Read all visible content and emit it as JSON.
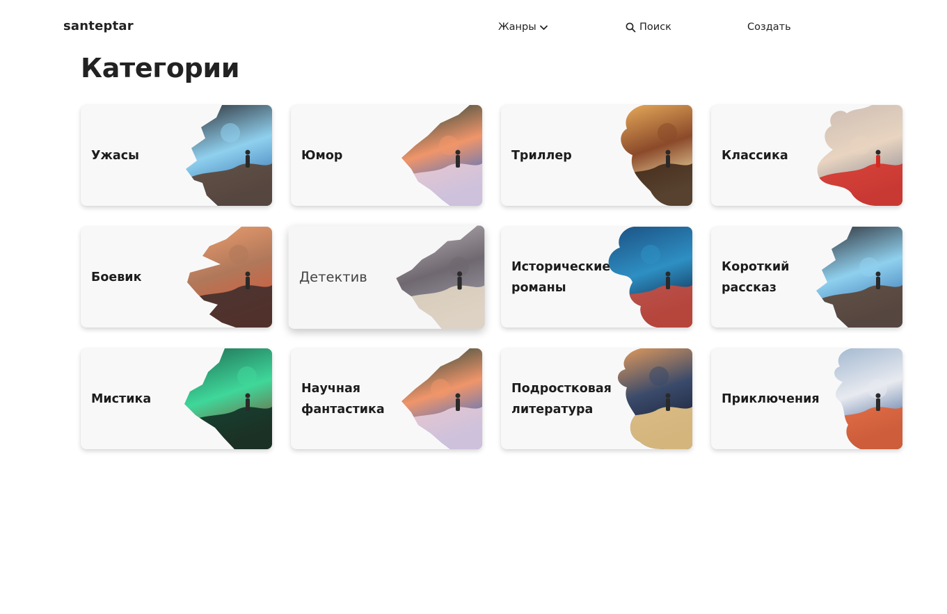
{
  "nav": {
    "logo": "santeptar",
    "genres_label": "Жанры",
    "search_label": "Поиск",
    "create_label": "Создать"
  },
  "page": {
    "title": "Категории"
  },
  "categories": [
    {
      "label": "Ужасы",
      "palette": [
        "#2a2a30",
        "#8fd0ee",
        "#5a3d2a",
        "#3b78b5"
      ]
    },
    {
      "label": "Юмор",
      "palette": [
        "#0f3b34",
        "#f0956a",
        "#e7d0de",
        "#3a6fd0"
      ]
    },
    {
      "label": "Триллер",
      "palette": [
        "#f2b660",
        "#8b4a2a",
        "#3a2418",
        "#f6e6b0"
      ]
    },
    {
      "label": "Классика",
      "palette": [
        "#cbbcb3",
        "#e8d4c0",
        "#d32a22",
        "#8e8c95"
      ]
    },
    {
      "label": "Боевик",
      "palette": [
        "#f0a070",
        "#b0785a",
        "#3a2a2a",
        "#d65a3a"
      ]
    },
    {
      "label": "Детектив",
      "palette": [
        "#bdb6b9",
        "#6f6870",
        "#e9dcc8",
        "#9b99a5"
      ]
    },
    {
      "label": "Исторические романы",
      "palette": [
        "#1b4e80",
        "#2e8fc3",
        "#d44a3a",
        "#0e2a4a"
      ]
    },
    {
      "label": "Короткий рассказ",
      "palette": [
        "#2a2a30",
        "#8fd0ee",
        "#5a3d2a",
        "#3b78b5"
      ]
    },
    {
      "label": "Мистика",
      "palette": [
        "#1e6a52",
        "#3fd79a",
        "#0c2a22",
        "#7a5a3a"
      ]
    },
    {
      "label": "Научная фантастика",
      "palette": [
        "#0f3b34",
        "#f0956a",
        "#e7d0de",
        "#3a6fd0"
      ]
    },
    {
      "label": "Подростковая литература",
      "palette": [
        "#f2a25a",
        "#3a4a6a",
        "#f6d08a",
        "#1a2238"
      ]
    },
    {
      "label": "Приключения",
      "palette": [
        "#9ab2cc",
        "#e8eaf0",
        "#e45a2a",
        "#4a6a9a"
      ]
    }
  ]
}
